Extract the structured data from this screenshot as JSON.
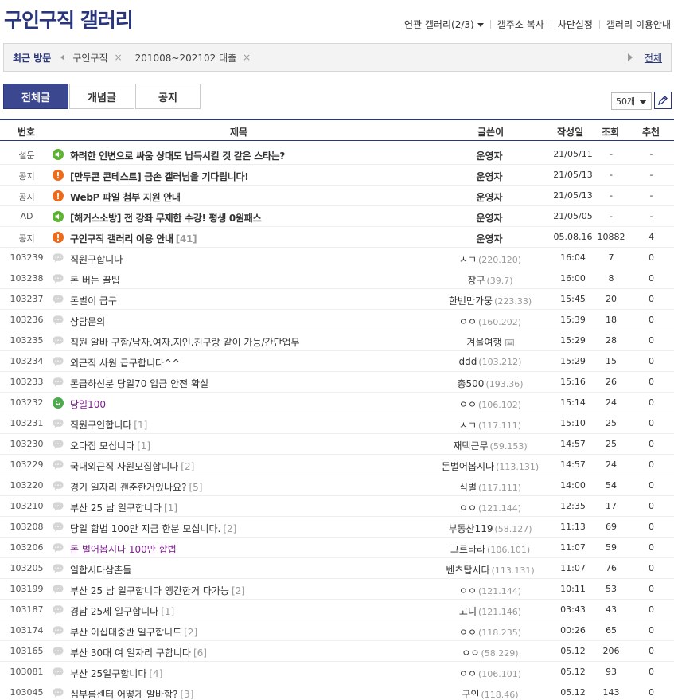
{
  "header": {
    "title": "구인구직 갤러리",
    "links": [
      "연관 갤러리(2/3)",
      "갤주소 복사",
      "차단설정",
      "갤러리 이용안내"
    ]
  },
  "recent": {
    "label": "최근 방문",
    "items": [
      "구인구직",
      "201008~202102 대출"
    ],
    "close_glyph": "×",
    "all_label": "전체"
  },
  "tabs": [
    "전체글",
    "개념글",
    "공지"
  ],
  "list_count": "50개",
  "columns": {
    "num": "번호",
    "title": "제목",
    "writer": "글쓴이",
    "date": "작성일",
    "views": "조회",
    "rec": "추천"
  },
  "rows": [
    {
      "num": "설문",
      "icon": "speaker-icon",
      "title": "화려한 언변으로 싸움 상대도 납득시킬 것 같은 스타는?",
      "replies": "",
      "writer": "운영자",
      "ip": "",
      "date": "21/05/11",
      "views": "-",
      "rec": "-"
    },
    {
      "num": "공지",
      "icon": "notice-icon",
      "title": "[만두콘 콘테스트] 금손 갤러님을 기다립니다!",
      "replies": "",
      "writer": "운영자",
      "ip": "",
      "date": "21/05/13",
      "views": "-",
      "rec": "-"
    },
    {
      "num": "공지",
      "icon": "notice-icon",
      "title": "WebP 파일 첨부 지원 안내",
      "replies": "",
      "writer": "운영자",
      "ip": "",
      "date": "21/05/13",
      "views": "-",
      "rec": "-"
    },
    {
      "num": "AD",
      "icon": "speaker-icon",
      "title": "[해커스소방] 전 강좌 무제한 수강! 평생 0원패스",
      "replies": "",
      "writer": "운영자",
      "ip": "",
      "date": "21/05/05",
      "views": "-",
      "rec": "-"
    },
    {
      "num": "공지",
      "icon": "notice-icon",
      "title": "구인구직 갤러리 이용 안내",
      "replies": "[41]",
      "writer": "운영자",
      "ip": "",
      "date": "05.08.16",
      "views": "10882",
      "rec": "4"
    },
    {
      "num": "103239",
      "icon": "comment-icon",
      "title": "직원구합니다",
      "replies": "",
      "writer": "ㅅㄱ",
      "ip": "(220.120)",
      "date": "16:04",
      "views": "7",
      "rec": "0"
    },
    {
      "num": "103238",
      "icon": "comment-icon",
      "title": "돈 버는 꿀팁",
      "replies": "",
      "writer": "장구",
      "ip": "(39.7)",
      "date": "16:00",
      "views": "8",
      "rec": "0"
    },
    {
      "num": "103237",
      "icon": "comment-icon",
      "title": " 돈벌이 급구",
      "replies": "",
      "writer": "한번만가뭉",
      "ip": "(223.33)",
      "date": "15:45",
      "views": "20",
      "rec": "0"
    },
    {
      "num": "103236",
      "icon": "comment-icon",
      "title": "상담문의",
      "replies": "",
      "writer": "ㅇㅇ",
      "ip": "(160.202)",
      "date": "15:39",
      "views": "18",
      "rec": "0"
    },
    {
      "num": "103235",
      "icon": "comment-icon",
      "title": "직원 알바 구함/남자.여자.지인.친구랑 같이 가능/간단업무",
      "replies": "",
      "writer": "겨울여행",
      "ip": "",
      "date": "15:29",
      "views": "28",
      "rec": "0"
    },
    {
      "num": "103234",
      "icon": "comment-icon",
      "title": "외근직 사원 급구합니다^^",
      "replies": "",
      "writer": "ddd",
      "ip": "(103.212)",
      "date": "15:29",
      "views": "15",
      "rec": "0"
    },
    {
      "num": "103233",
      "icon": "comment-icon",
      "title": "돈급하신분 당일70 입금 안전 확실",
      "replies": "",
      "writer": "총500",
      "ip": "(193.36)",
      "date": "15:16",
      "views": "26",
      "rec": "0"
    },
    {
      "num": "103232",
      "icon": "image-icon",
      "title": "당일100",
      "replies": "",
      "writer": "ㅇㅇ",
      "ip": "(106.102)",
      "date": "15:14",
      "views": "24",
      "rec": "0"
    },
    {
      "num": "103231",
      "icon": "comment-icon",
      "title": "직원구인합니다",
      "replies": "[1]",
      "writer": "ㅅㄱ",
      "ip": "(117.111)",
      "date": "15:10",
      "views": "25",
      "rec": "0"
    },
    {
      "num": "103230",
      "icon": "comment-icon",
      "title": "오다집 모십니다",
      "replies": "[1]",
      "writer": "재택근무",
      "ip": "(59.153)",
      "date": "14:57",
      "views": "25",
      "rec": "0"
    },
    {
      "num": "103229",
      "icon": "comment-icon",
      "title": "국내외근직 사원모집합니다",
      "replies": "[2]",
      "writer": "돈벌어봅시다",
      "ip": "(113.131)",
      "date": "14:57",
      "views": "24",
      "rec": "0"
    },
    {
      "num": "103220",
      "icon": "comment-icon",
      "title": "경기 일자리 괜춘한거있나요?",
      "replies": "[5]",
      "writer": "식벌",
      "ip": "(117.111)",
      "date": "14:00",
      "views": "54",
      "rec": "0"
    },
    {
      "num": "103210",
      "icon": "comment-icon",
      "title": "부산 25 남 일구합니다",
      "replies": "[1]",
      "writer": "ㅇㅇ",
      "ip": "(121.144)",
      "date": "12:35",
      "views": "17",
      "rec": "0"
    },
    {
      "num": "103208",
      "icon": "comment-icon",
      "title": "당일 합법 100만 지금 한분 모십니다.",
      "replies": "[2]",
      "writer": "부동산119",
      "ip": "(58.127)",
      "date": "11:13",
      "views": "69",
      "rec": "0"
    },
    {
      "num": "103206",
      "icon": "comment-icon",
      "title": "돈 벌어봅시다 100만 합법",
      "replies": "",
      "writer": "그르타라",
      "ip": "(106.101)",
      "date": "11:07",
      "views": "59",
      "rec": "0"
    },
    {
      "num": "103205",
      "icon": "comment-icon",
      "title": "일합시다삼촌들",
      "replies": "",
      "writer": "벤츠탑시다",
      "ip": "(113.131)",
      "date": "11:07",
      "views": "76",
      "rec": "0"
    },
    {
      "num": "103199",
      "icon": "comment-icon",
      "title": "부산 25 남 일구합니다 엥간한거 다가능",
      "replies": "[2]",
      "writer": "ㅇㅇ",
      "ip": "(121.144)",
      "date": "10:11",
      "views": "53",
      "rec": "0"
    },
    {
      "num": "103187",
      "icon": "comment-icon",
      "title": "경남 25세 일구합니다",
      "replies": "[1]",
      "writer": "고니",
      "ip": "(121.146)",
      "date": "03:43",
      "views": "43",
      "rec": "0"
    },
    {
      "num": "103174",
      "icon": "comment-icon",
      "title": "부산 이십대중반 일구합니드",
      "replies": "[2]",
      "writer": "ㅇㅇ",
      "ip": "(118.235)",
      "date": "00:26",
      "views": "65",
      "rec": "0"
    },
    {
      "num": "103165",
      "icon": "comment-icon",
      "title": "부산 30대 여 일자리 구합니다",
      "replies": "[6]",
      "writer": "ㅇㅇ",
      "ip": "(58.229)",
      "date": "05.12",
      "views": "206",
      "rec": "0"
    },
    {
      "num": "103081",
      "icon": "comment-icon",
      "title": "부산 25일구합니다",
      "replies": "[4]",
      "writer": "ㅇㅇ",
      "ip": "(106.101)",
      "date": "05.12",
      "views": "93",
      "rec": "0"
    },
    {
      "num": "103045",
      "icon": "comment-icon",
      "title": "심부름센터 어떻게 알바함?",
      "replies": "[3]",
      "writer": "구인",
      "ip": "(118.46)",
      "date": "05.12",
      "views": "143",
      "rec": "0"
    }
  ],
  "colors": {
    "brand": "#29367c",
    "active_tab": "#3b4890",
    "purple_title": "#7d1f8e",
    "green_icon": "#5cb531",
    "orange_icon": "#ee6b1c"
  }
}
